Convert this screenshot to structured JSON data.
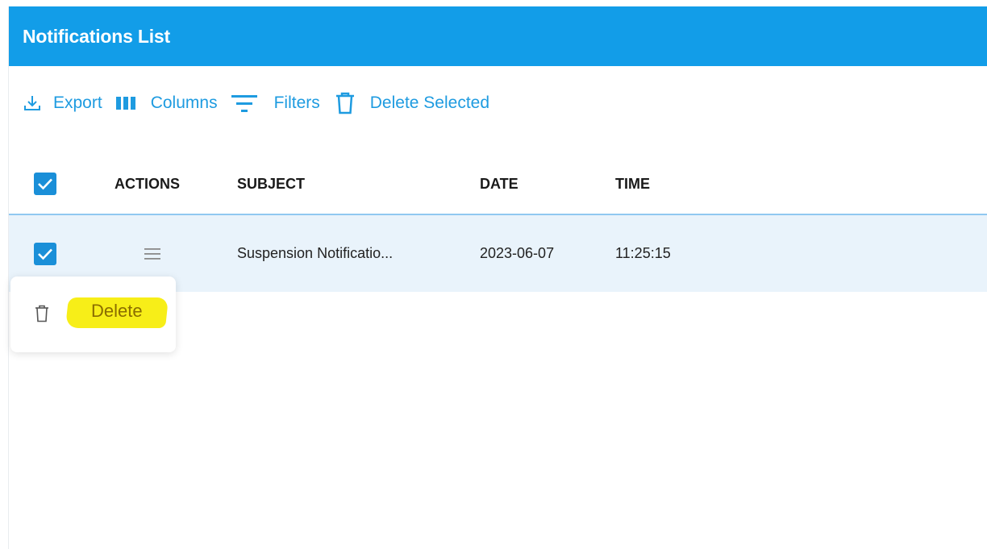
{
  "header": {
    "title": "Notifications List"
  },
  "toolbar": {
    "export_label": "Export",
    "columns_label": "Columns",
    "filters_label": "Filters",
    "delete_selected_label": "Delete Selected"
  },
  "table": {
    "columns": [
      "ACTIONS",
      "SUBJECT",
      "DATE",
      "TIME"
    ],
    "rows": [
      {
        "selected": true,
        "subject": "Suspension Notificatio...",
        "date": "2023-06-07",
        "time": "11:25:15"
      }
    ]
  },
  "row_menu": {
    "items": [
      {
        "label": "Delete",
        "icon": "trash-icon",
        "highlighted": true
      }
    ]
  },
  "colors": {
    "header": "#129de8",
    "accent": "#1e9be0",
    "selected_row": "#e9f3fb",
    "highlight": "#f7ee18"
  }
}
